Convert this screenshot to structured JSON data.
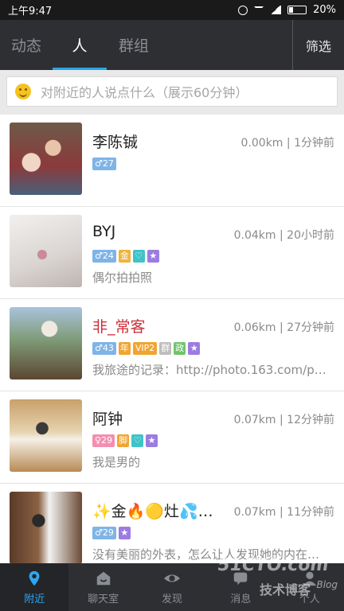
{
  "status": {
    "time": "上午9:47",
    "battery": "20%"
  },
  "tabs": [
    {
      "label": "动态"
    },
    {
      "label": "人"
    },
    {
      "label": "群组"
    }
  ],
  "filter_label": "筛选",
  "search": {
    "placeholder": "对附近的人说点什么（展示60分钟）"
  },
  "people": [
    {
      "name": "李陈铖",
      "distance": "0.00km",
      "time": "1分钟前",
      "age": "♂27",
      "signature": ""
    },
    {
      "name": "BYJ",
      "distance": "0.04km",
      "time": "20小时前",
      "age": "♂24",
      "badges": [
        "金",
        "♡",
        "★"
      ],
      "signature": "偶尔拍拍照"
    },
    {
      "name": "非_常客",
      "distance": "0.06km",
      "time": "27分钟前",
      "age": "♂43",
      "badges": [
        "年",
        "VIP2",
        "群",
        "政",
        "★"
      ],
      "signature": "我旅途的记录：http://photo.163.com/p…"
    },
    {
      "name": "阿钟",
      "distance": "0.07km",
      "time": "12分钟前",
      "age": "♀29",
      "badges": [
        "脚",
        "♡",
        "★"
      ],
      "signature": "我是男的"
    },
    {
      "name": "✨金🔥🟡灶💦…",
      "distance": "0.07km",
      "time": "11分钟前",
      "age": "♂29",
      "badges": [
        "★"
      ],
      "signature": "没有美丽的外表，怎么让人发现她的内在…"
    }
  ],
  "bottom_nav": [
    {
      "label": "附近",
      "icon": "location-pin-icon"
    },
    {
      "label": "聊天室",
      "icon": "chat-house-icon"
    },
    {
      "label": "发现",
      "icon": "eye-icon"
    },
    {
      "label": "消息",
      "icon": "message-icon"
    },
    {
      "label": "个人",
      "icon": "person-icon"
    }
  ],
  "watermark": {
    "site": "51CTO.com",
    "sub": "技术博客",
    "blog": "Blog"
  },
  "colors": {
    "accent": "#28a5e8",
    "nav_bg": "#2d2f33",
    "name_red": "#cc2f3a"
  }
}
